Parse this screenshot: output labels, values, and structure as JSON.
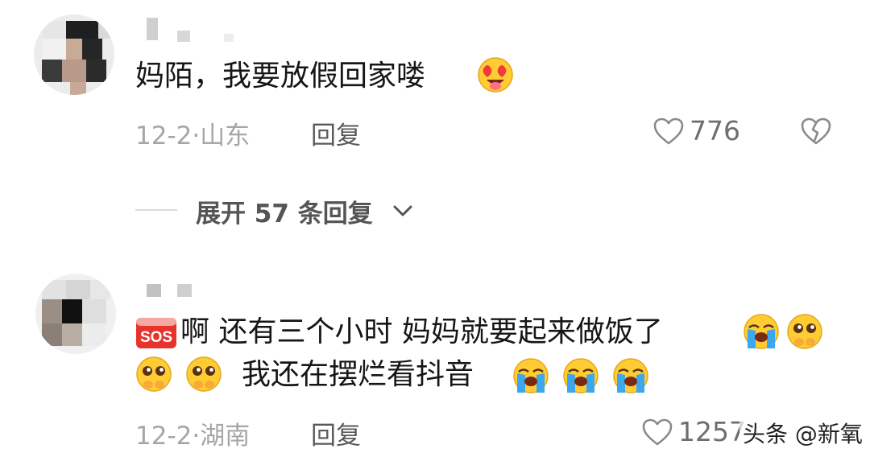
{
  "comments": [
    {
      "text": "妈陌，我要放假回家喽",
      "date_location": "12-2·山东",
      "reply_label": "回复",
      "likes": "776",
      "expand_replies": "展开 57 条回复"
    },
    {
      "badge_text": "SOS",
      "line1": "啊 还有三个小时 妈妈就要起来做饭了",
      "line2": "我还在摆烂看抖音",
      "date_location": "12-2·湖南",
      "reply_label": "回复",
      "likes": "1257"
    }
  ],
  "watermark": "头条 @新氧",
  "icons": {
    "like": "heart-outline-icon",
    "dislike": "broken-heart-icon",
    "expand": "chevron-down-icon",
    "emoji_heart_eyes": "heart-eyes-emoji",
    "emoji_crying": "loudly-crying-emoji",
    "emoji_pleading": "pleading-face-emoji"
  },
  "colors": {
    "meta_gray": "#a6a6a6",
    "sos_red": "#e8332c"
  }
}
